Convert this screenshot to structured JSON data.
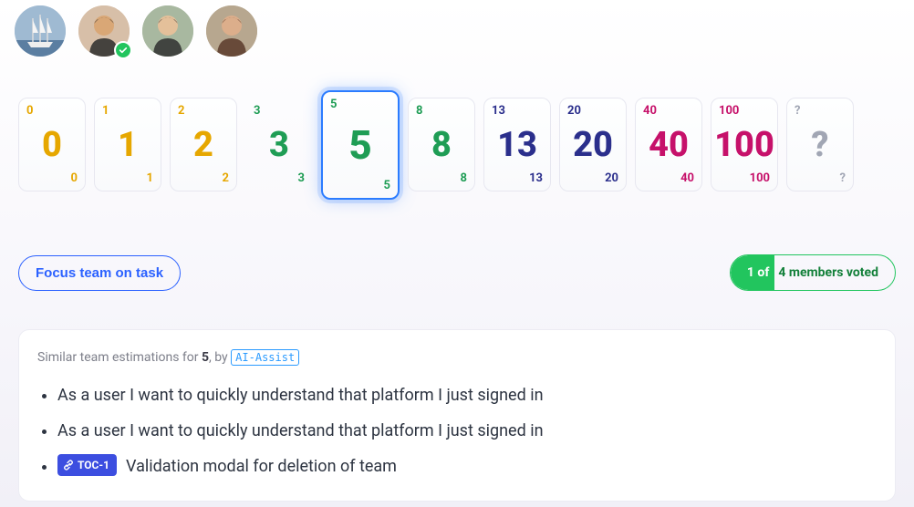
{
  "avatars": [
    {
      "name": "member-1",
      "bg": "#9fbad2",
      "face": "#e8d2b8",
      "hair": "#3a3a3a",
      "checked": false,
      "boat": true
    },
    {
      "name": "member-2",
      "bg": "#d7bfa8",
      "face": "#d9a776",
      "hair": "#2b2b2b",
      "checked": true
    },
    {
      "name": "member-3",
      "bg": "#a8b8a0",
      "face": "#e4c09a",
      "hair": "#2f2f2f",
      "checked": false
    },
    {
      "name": "member-4",
      "bg": "#b7a78f",
      "face": "#dcae8b",
      "hair": "#5a3a2a",
      "checked": false
    }
  ],
  "cards": [
    {
      "v": "0",
      "color": "c-amber",
      "bordered": true
    },
    {
      "v": "1",
      "color": "c-amber",
      "bordered": true
    },
    {
      "v": "2",
      "color": "c-amber",
      "bordered": true
    },
    {
      "v": "3",
      "color": "c-green",
      "bordered": false
    },
    {
      "v": "5",
      "color": "c-green",
      "bordered": true,
      "selected": true
    },
    {
      "v": "8",
      "color": "c-green",
      "bordered": true
    },
    {
      "v": "13",
      "color": "c-indigo",
      "bordered": true
    },
    {
      "v": "20",
      "color": "c-indigo",
      "bordered": true
    },
    {
      "v": "40",
      "color": "c-rose",
      "bordered": true
    },
    {
      "v": "100",
      "color": "c-rose",
      "bordered": true
    },
    {
      "v": "?",
      "color": "c-gray",
      "bordered": true
    }
  ],
  "focus_btn": "Focus team on task",
  "votes": {
    "filled": "1 of",
    "rest": " 4 members voted"
  },
  "similar": {
    "lead_prefix": "Similar team estimations for ",
    "lead_value": "5",
    "lead_by": ", by ",
    "ai_label": "AI-Assist",
    "items": [
      {
        "text": "As a user I want to quickly understand that platform I just signed in"
      },
      {
        "text": "As a user I want to quickly understand that platform I just signed in"
      },
      {
        "badge": "TOC-1",
        "text": "Validation modal for deletion of team"
      }
    ]
  }
}
